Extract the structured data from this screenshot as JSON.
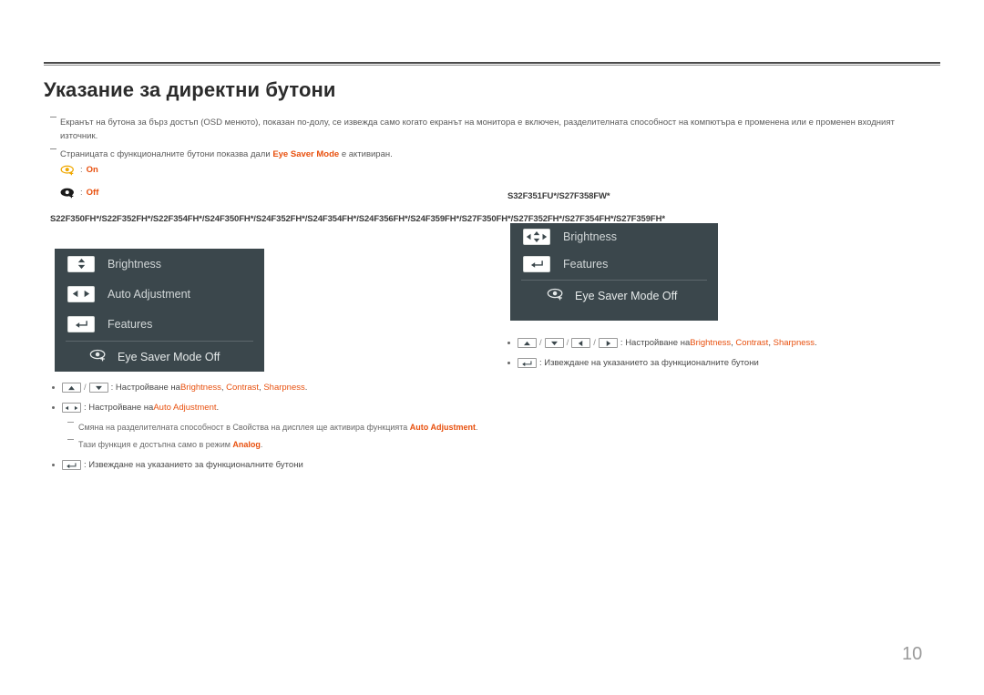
{
  "document": {
    "title": "Указание за директни бутони",
    "page_number": "10"
  },
  "notes": [
    {
      "id": "note-osd-visibility",
      "text": "Екранът на бутона за бърз достъп (OSD менюто), показан по-долу, се извежда само когато екранът на монитора е включен, разделителната способност на компютъра е променена или е променен входният източник."
    }
  ],
  "note_eye_saver": {
    "prefix": "Страницата с функционалните бутони показва дали ",
    "highlight": "Eye Saver Mode",
    "suffix": " е активиран."
  },
  "eye_legend": [
    {
      "icon": "eye-saver-on-icon",
      "separator": ":",
      "state": "On"
    },
    {
      "icon": "eye-saver-off-icon",
      "separator": ":",
      "state": "Off"
    }
  ],
  "left_section": {
    "models": "S22F350FH*/S22F352FH*/S22F354FH*/S24F350FH*/S24F352FH*/S24F354FH*/S24F356FH*/S24F359FH*/S27F350FH*/S27F352FH*/S27F354FH*/S27F359FH*",
    "osd": {
      "rows": [
        {
          "icon": "up-down-arrows-icon",
          "label": "Brightness"
        },
        {
          "icon": "left-right-arrows-icon",
          "label": "Auto Adjustment"
        },
        {
          "icon": "enter-key-icon",
          "label": "Features"
        }
      ],
      "eye_row": {
        "icon": "eye-saver-icon",
        "label": "Eye Saver Mode Off"
      }
    },
    "bullets": [
      {
        "keys": [
          "up-arrow-key",
          "down-arrow-key"
        ],
        "prefix": ": Настройване на ",
        "highlights": [
          "Brightness",
          "Contrast",
          "Sharpness"
        ],
        "suffix": "."
      },
      {
        "keys": [
          "left-right-arrow-key"
        ],
        "prefix": ": Настройване на ",
        "highlights": [
          "Auto Adjustment"
        ],
        "suffix": "."
      },
      {
        "keys": [
          "enter-key"
        ],
        "prefix": ": Извеждане на указанието за функционалните бутони",
        "highlights": [],
        "suffix": ""
      }
    ],
    "subnotes": [
      {
        "prefix": "Смяна на разделителната способност в Свойства на дисплея ще активира функцията ",
        "highlight": "Auto Adjustment",
        "suffix": "."
      },
      {
        "prefix": "Тази функция е достъпна само в режим ",
        "highlight": "Analog",
        "suffix": "."
      }
    ]
  },
  "right_section": {
    "models": "S32F351FU*/S27F358FW*",
    "osd": {
      "rows": [
        {
          "icon": "four-way-arrows-icon",
          "label": "Brightness"
        },
        {
          "icon": "enter-key-icon",
          "label": "Features"
        }
      ],
      "eye_row": {
        "icon": "eye-saver-icon",
        "label": "Eye Saver Mode Off"
      }
    },
    "bullets": [
      {
        "keys": [
          "up-arrow-key",
          "down-arrow-key",
          "left-arrow-key",
          "right-arrow-key"
        ],
        "prefix": ": Настройване на ",
        "highlights": [
          "Brightness",
          "Contrast",
          "Sharpness"
        ],
        "suffix": "."
      },
      {
        "keys": [
          "enter-key"
        ],
        "prefix": ": Извеждане на указанието за функционалните бутони",
        "highlights": [],
        "suffix": ""
      }
    ]
  },
  "colors": {
    "accent": "#e8500e",
    "osd_background": "#3b474c",
    "osd_text": "#d2d7d8",
    "eye_on": "#f0a800"
  }
}
